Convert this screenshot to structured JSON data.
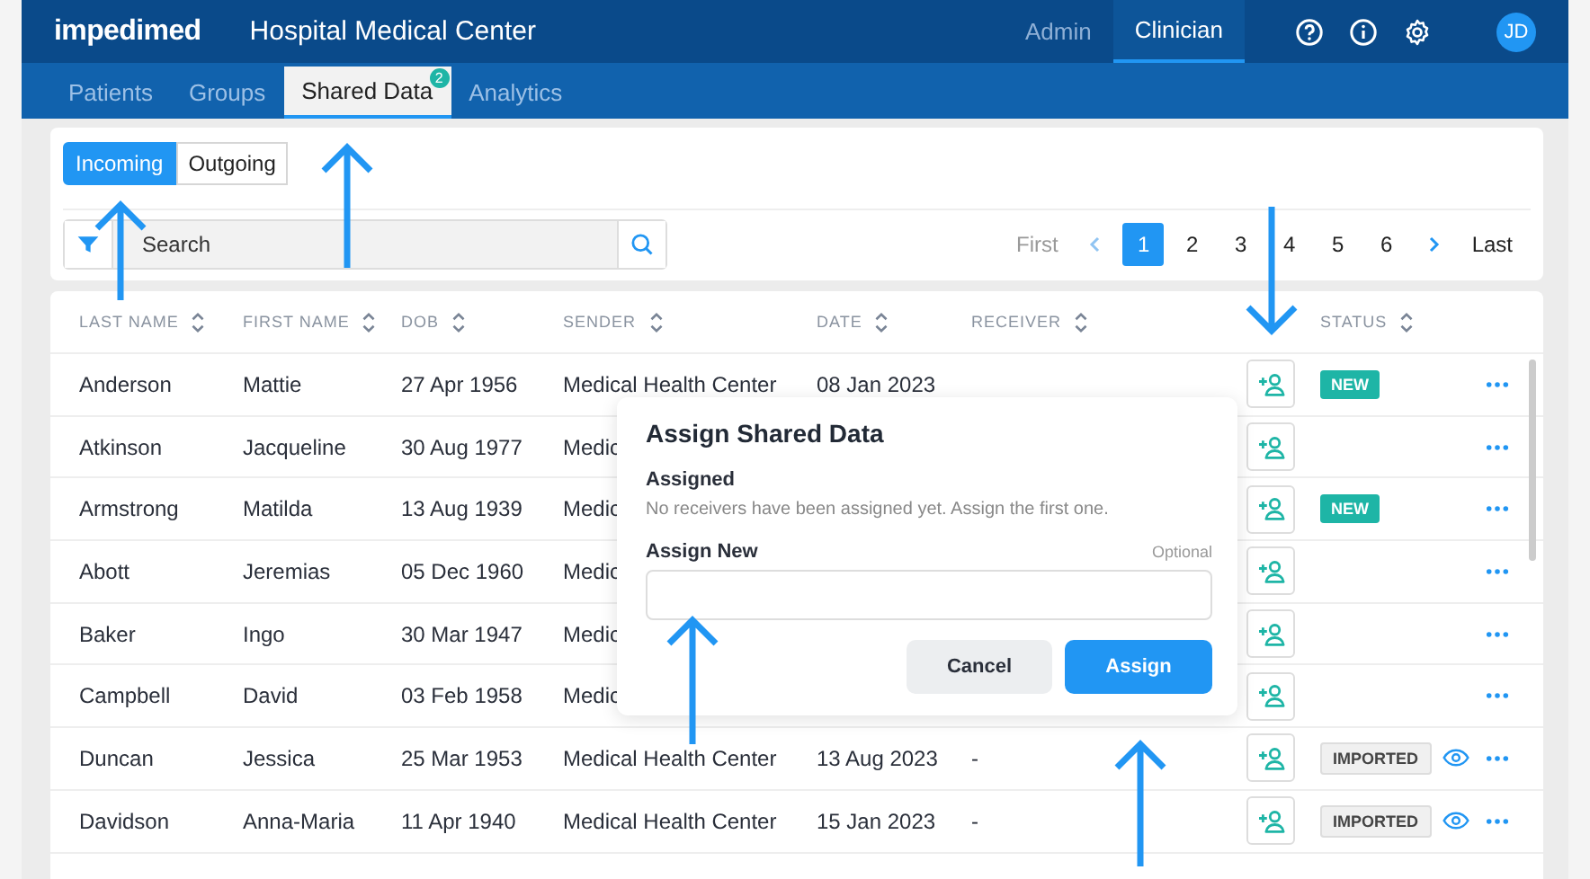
{
  "header": {
    "logo": "impedimed",
    "title": "Hospital Medical Center",
    "roles": [
      {
        "label": "Admin",
        "selected": false
      },
      {
        "label": "Clinician",
        "selected": true
      }
    ],
    "avatar": "JD"
  },
  "nav": [
    {
      "label": "Patients",
      "selected": false
    },
    {
      "label": "Groups",
      "selected": false
    },
    {
      "label": "Shared Data",
      "selected": true,
      "badge": "2"
    },
    {
      "label": "Analytics",
      "selected": false
    }
  ],
  "direction_tabs": [
    {
      "label": "Incoming",
      "selected": true
    },
    {
      "label": "Outgoing",
      "selected": false
    }
  ],
  "search": {
    "placeholder": "Search"
  },
  "pagination": {
    "first": "First",
    "last": "Last",
    "pages": [
      {
        "label": "1",
        "selected": true
      },
      {
        "label": "2",
        "selected": false
      },
      {
        "label": "3",
        "selected": false
      },
      {
        "label": "4",
        "selected": false
      },
      {
        "label": "5",
        "selected": false
      },
      {
        "label": "6",
        "selected": false
      }
    ]
  },
  "table": {
    "columns": [
      "LAST NAME",
      "FIRST NAME",
      "DOB",
      "SENDER",
      "DATE",
      "RECEIVER",
      "STATUS"
    ],
    "rows": [
      {
        "last_name": "Anderson",
        "first_name": "Mattie",
        "dob": "27 Apr 1956",
        "sender": "Medical Health Center",
        "date": "08 Jan 2023",
        "status": {
          "kind": "new",
          "label": "NEW"
        }
      },
      {
        "last_name": "Atkinson",
        "first_name": "Jacqueline",
        "dob": "30 Aug 1977",
        "sender": "Medic"
      },
      {
        "last_name": "Armstrong",
        "first_name": "Matilda",
        "dob": "13 Aug 1939",
        "sender": "Medic",
        "status": {
          "kind": "new",
          "label": "NEW"
        }
      },
      {
        "last_name": "Abott",
        "first_name": "Jeremias",
        "dob": "05 Dec 1960",
        "sender": "Medic"
      },
      {
        "last_name": "Baker",
        "first_name": "Ingo",
        "dob": "30 Mar 1947",
        "sender": "Medic"
      },
      {
        "last_name": "Campbell",
        "first_name": "David",
        "dob": "03 Feb 1958",
        "sender": "Medic"
      },
      {
        "last_name": "Duncan",
        "first_name": "Jessica",
        "dob": "25 Mar 1953",
        "sender": "Medical Health Center",
        "date": "13 Aug 2023",
        "receiver": "-",
        "status": {
          "kind": "imported",
          "label": "IMPORTED"
        }
      },
      {
        "last_name": "Davidson",
        "first_name": "Anna-Maria",
        "dob": "11 Apr 1940",
        "sender": "Medical Health Center",
        "date": "15 Jan 2023",
        "receiver": "-",
        "status": {
          "kind": "imported",
          "label": "IMPORTED"
        }
      }
    ]
  },
  "dialog": {
    "title": "Assign Shared Data",
    "assigned_label": "Assigned",
    "assigned_text": "No receivers have been assigned yet. Assign the first one.",
    "assign_new_label": "Assign New",
    "optional": "Optional",
    "buttons": [
      {
        "kind": "secondary",
        "label": "Cancel"
      },
      {
        "kind": "primary",
        "label": "Assign"
      }
    ]
  }
}
